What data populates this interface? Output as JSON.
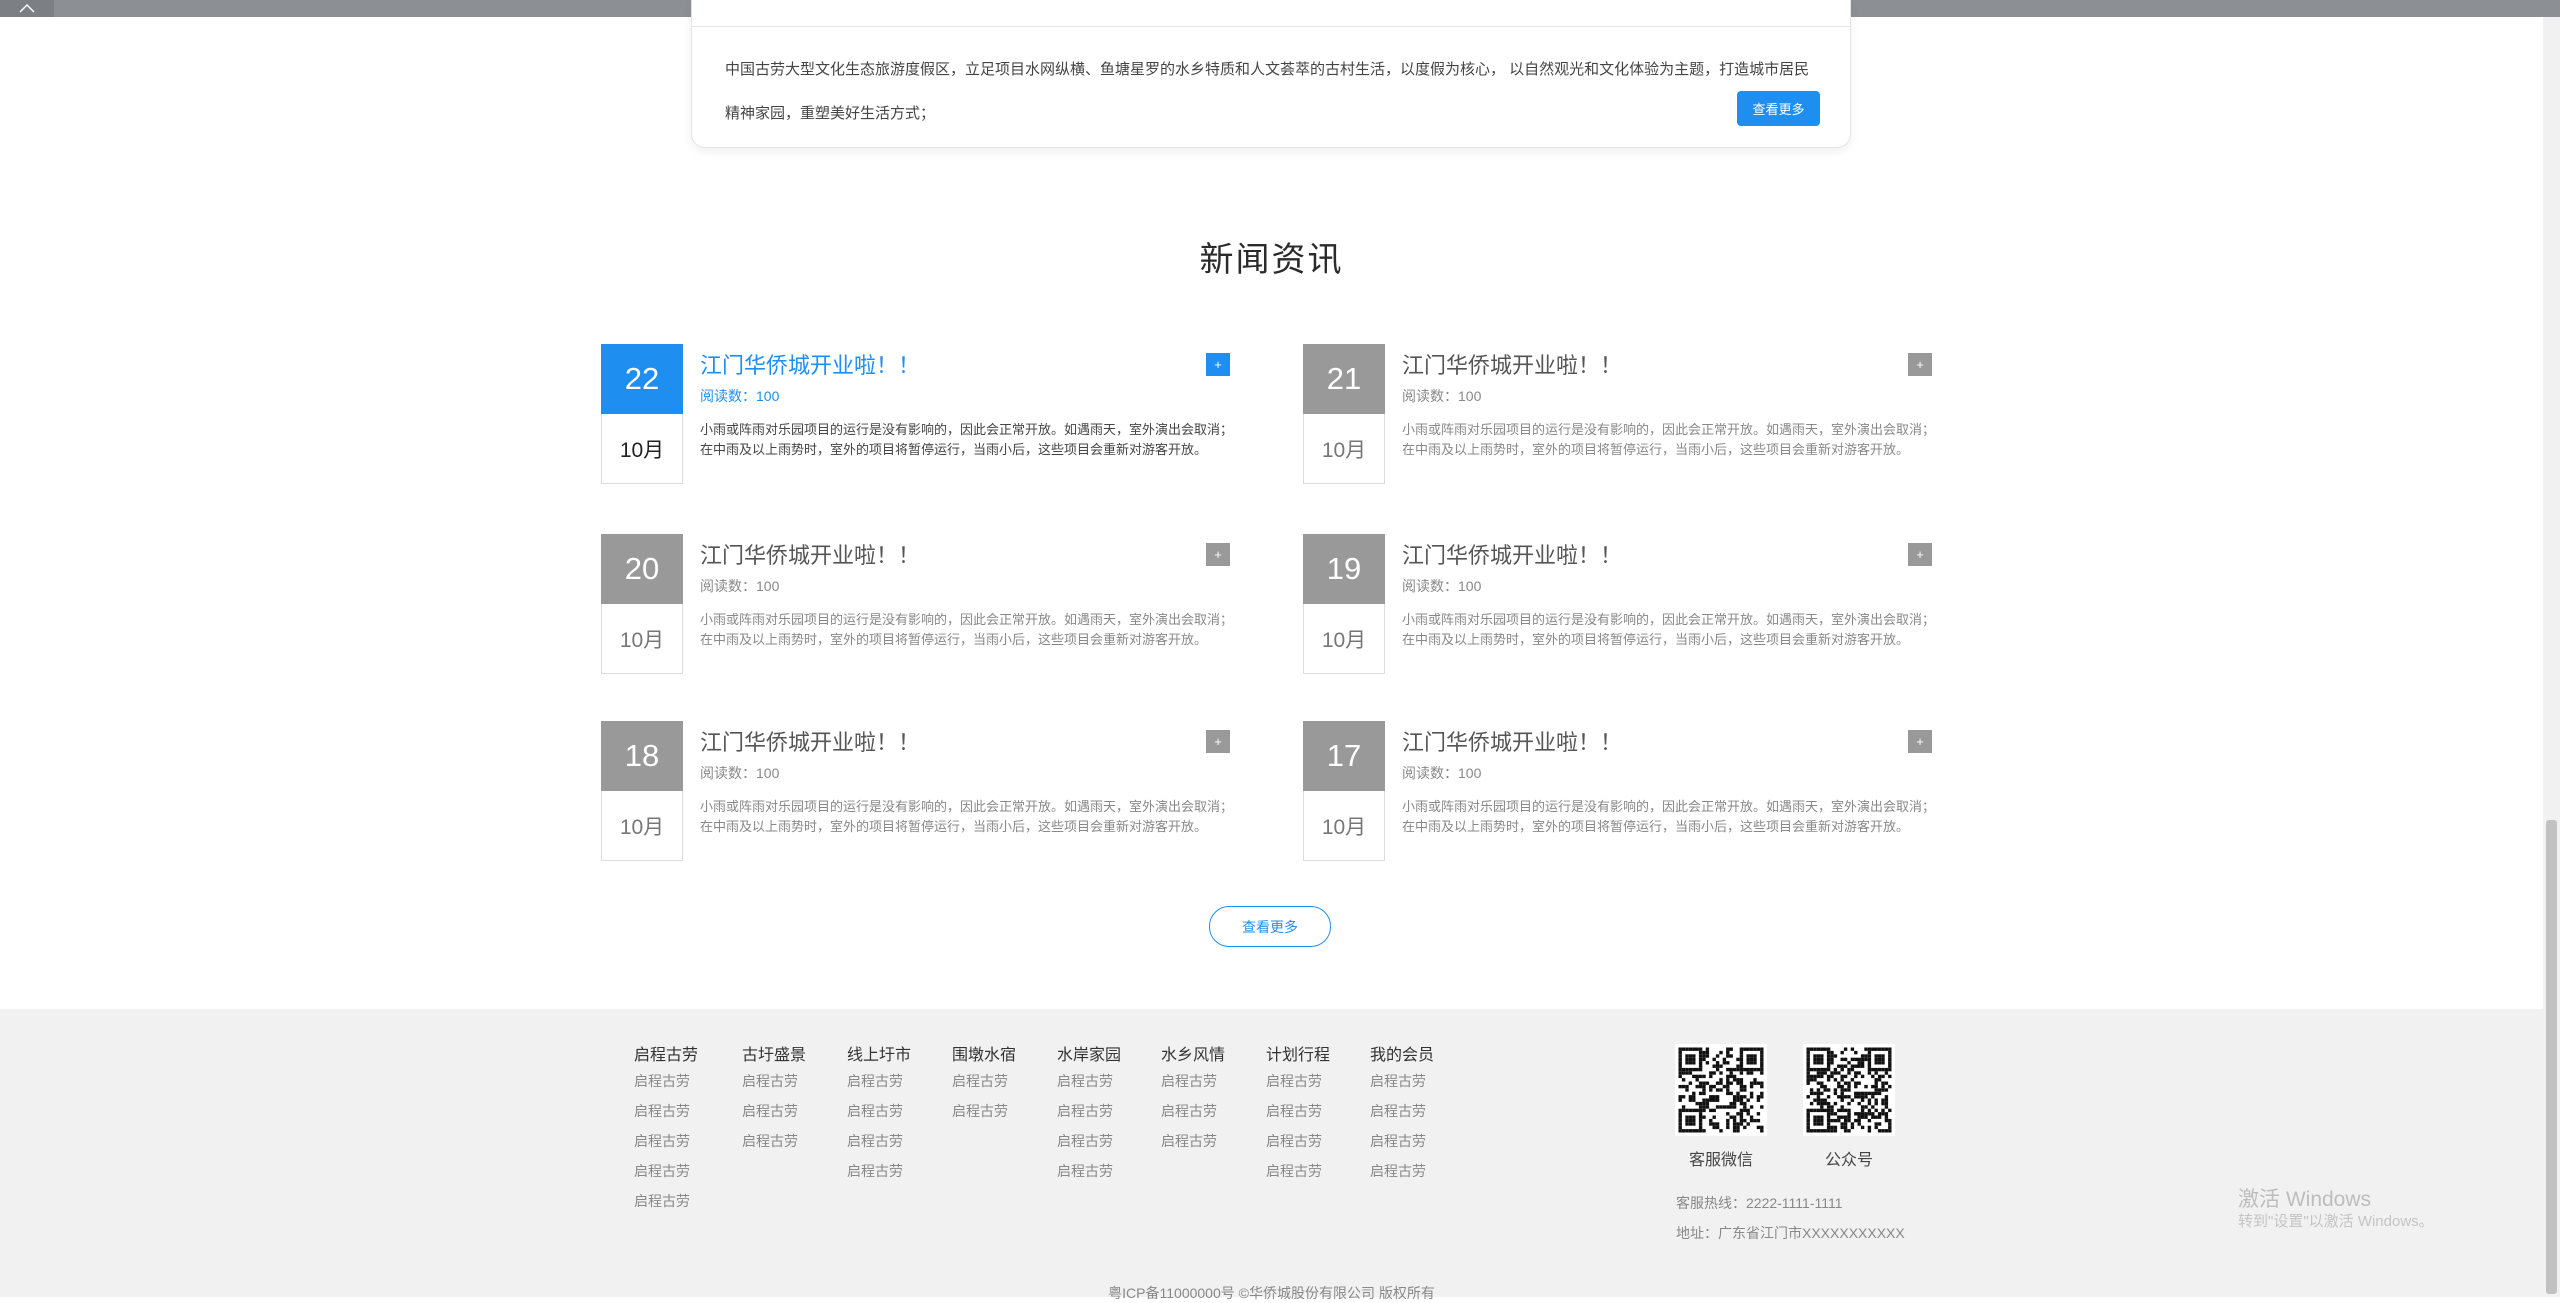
{
  "intro": {
    "text": "中国古劳大型文化生态旅游度假区，立足项目水网纵横、鱼塘星罗的水乡特质和人文荟萃的古村生活，以度假为核心， 以自然观光和文化体验为主题，打造城市居民精神家园，重塑美好生活方式；",
    "more_label": "查看更多"
  },
  "news": {
    "section_title": "新闻资讯",
    "items": [
      {
        "day": "22",
        "month": "10月",
        "title": "江门华侨城开业啦！！",
        "reads": "阅读数：100",
        "desc": "小雨或阵雨对乐园项目的运行是没有影响的，因此会正常开放。如遇雨天，室外演出会取消；在中雨及以上雨势时，室外的项目将暂停运行，当雨小后，这些项目会重新对游客开放。",
        "plus": "+",
        "active": true
      },
      {
        "day": "21",
        "month": "10月",
        "title": "江门华侨城开业啦！！",
        "reads": "阅读数：100",
        "desc": "小雨或阵雨对乐园项目的运行是没有影响的，因此会正常开放。如遇雨天，室外演出会取消；在中雨及以上雨势时，室外的项目将暂停运行，当雨小后，这些项目会重新对游客开放。",
        "plus": "+",
        "active": false
      },
      {
        "day": "20",
        "month": "10月",
        "title": "江门华侨城开业啦！！",
        "reads": "阅读数：100",
        "desc": "小雨或阵雨对乐园项目的运行是没有影响的，因此会正常开放。如遇雨天，室外演出会取消；在中雨及以上雨势时，室外的项目将暂停运行，当雨小后，这些项目会重新对游客开放。",
        "plus": "+",
        "active": false
      },
      {
        "day": "19",
        "month": "10月",
        "title": "江门华侨城开业啦！！",
        "reads": "阅读数：100",
        "desc": "小雨或阵雨对乐园项目的运行是没有影响的，因此会正常开放。如遇雨天，室外演出会取消；在中雨及以上雨势时，室外的项目将暂停运行，当雨小后，这些项目会重新对游客开放。",
        "plus": "+",
        "active": false
      },
      {
        "day": "18",
        "month": "10月",
        "title": "江门华侨城开业啦！！",
        "reads": "阅读数：100",
        "desc": "小雨或阵雨对乐园项目的运行是没有影响的，因此会正常开放。如遇雨天，室外演出会取消；在中雨及以上雨势时，室外的项目将暂停运行，当雨小后，这些项目会重新对游客开放。",
        "plus": "+",
        "active": false
      },
      {
        "day": "17",
        "month": "10月",
        "title": "江门华侨城开业啦！！",
        "reads": "阅读数：100",
        "desc": "小雨或阵雨对乐园项目的运行是没有影响的，因此会正常开放。如遇雨天，室外演出会取消；在中雨及以上雨势时，室外的项目将暂停运行，当雨小后，这些项目会重新对游客开放。",
        "plus": "+",
        "active": false
      }
    ],
    "more_label": "查看更多"
  },
  "footer": {
    "columns": [
      {
        "head": "启程古劳",
        "links": [
          "启程古劳",
          "启程古劳",
          "启程古劳",
          "启程古劳",
          "启程古劳"
        ]
      },
      {
        "head": "古圩盛景",
        "links": [
          "启程古劳",
          "启程古劳",
          "启程古劳"
        ]
      },
      {
        "head": "线上圩市",
        "links": [
          "启程古劳",
          "启程古劳",
          "启程古劳",
          "启程古劳"
        ]
      },
      {
        "head": "围墩水宿",
        "links": [
          "启程古劳",
          "启程古劳"
        ]
      },
      {
        "head": "水岸家园",
        "links": [
          "启程古劳",
          "启程古劳",
          "启程古劳",
          "启程古劳"
        ]
      },
      {
        "head": "水乡风情",
        "links": [
          "启程古劳",
          "启程古劳",
          "启程古劳"
        ]
      },
      {
        "head": "计划行程",
        "links": [
          "启程古劳",
          "启程古劳",
          "启程古劳",
          "启程古劳"
        ]
      },
      {
        "head": "我的会员",
        "links": [
          "启程古劳",
          "启程古劳",
          "启程古劳",
          "启程古劳"
        ]
      }
    ],
    "qr_service_label": "客服微信",
    "qr_official_label": "公众号",
    "hotline": "客服热线：2222-1111-1111",
    "address": "地址：广东省江门市XXXXXXXXXXX",
    "icp": "粤ICP备11000000号 ©华侨城股份有限公司 版权所有"
  },
  "os_watermark": {
    "line1": "激活 Windows",
    "line2": "转到\"设置\"以激活 Windows。"
  },
  "colors": {
    "accent": "#1e8ff0",
    "inactive": "#999999",
    "footer_bg": "#f1f1f1"
  }
}
